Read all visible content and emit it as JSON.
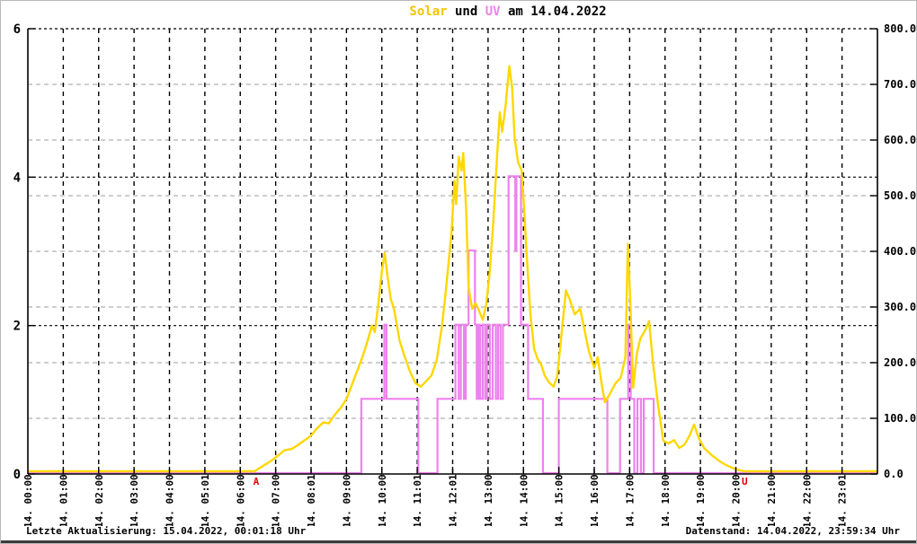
{
  "title": {
    "parts": [
      {
        "text": "Solar",
        "color": "#f5c400"
      },
      {
        "text": " und ",
        "color": "#000000"
      },
      {
        "text": "UV",
        "color": "#ee82ee"
      },
      {
        "text": " am 14.04.2022",
        "color": "#000000"
      }
    ]
  },
  "footer": {
    "left": "Letzte Aktualisierung: 15.04.2022, 00:01:18 Uhr",
    "right": "Datenstand: 14.04.2022, 23:59:34 Uhr"
  },
  "chart_data": {
    "type": "line",
    "title": "Solar und UV am 14.04.2022",
    "grid": {
      "hour_line_color": "#000000",
      "left_line_color": "#000000",
      "right_line_color": "#bdbdbd"
    },
    "x_axis": {
      "hours": [
        0,
        1,
        2,
        3,
        4,
        5,
        6,
        7,
        8,
        9,
        10,
        11,
        12,
        13,
        14,
        15,
        16,
        17,
        18,
        19,
        20,
        21,
        22,
        23
      ],
      "labels": [
        "14. 00:00",
        "14. 01:00",
        "14. 02:00",
        "14. 03:00",
        "14. 04:00",
        "14. 05:01",
        "14. 06:00",
        "14. 07:00",
        "14. 08:01",
        "14. 09:00",
        "14. 10:00",
        "14. 11:01",
        "14. 12:01",
        "14. 13:00",
        "14. 14:00",
        "14. 15:00",
        "14. 16:00",
        "14. 17:00",
        "14. 18:00",
        "14. 19:00",
        "14. 20:00",
        "14. 21:00",
        "14. 22:00",
        "14. 23:01"
      ],
      "range": [
        0,
        24
      ]
    },
    "left_axis": {
      "range": [
        0,
        6
      ],
      "ticks": [
        0,
        2,
        4,
        6
      ],
      "tick_labels": [
        "0",
        "2",
        "4",
        "6"
      ]
    },
    "right_axis": {
      "range": [
        0,
        800
      ],
      "ticks": [
        0,
        100,
        200,
        300,
        400,
        500,
        600,
        700,
        800
      ],
      "tick_labels": [
        "0.0",
        "100.0",
        "200.0",
        "300.0",
        "400.0",
        "500.0",
        "600.0",
        "700.0",
        "800.0"
      ]
    },
    "sun_markers": {
      "color": "#e00000",
      "items": [
        {
          "label": "A",
          "hour": 6.45
        },
        {
          "label": "U",
          "hour": 20.25
        }
      ]
    },
    "series": [
      {
        "name": "UV",
        "axis": "left",
        "color": "#ee82ee",
        "style": "step",
        "points": [
          [
            0,
            0
          ],
          [
            9.42,
            1
          ],
          [
            10.07,
            2
          ],
          [
            10.13,
            1
          ],
          [
            11.03,
            0
          ],
          [
            11.57,
            1
          ],
          [
            12.08,
            2
          ],
          [
            12.17,
            1
          ],
          [
            12.23,
            2
          ],
          [
            12.32,
            1
          ],
          [
            12.37,
            2
          ],
          [
            12.45,
            3
          ],
          [
            12.63,
            2
          ],
          [
            12.68,
            1
          ],
          [
            12.73,
            2
          ],
          [
            12.78,
            1
          ],
          [
            12.85,
            2
          ],
          [
            12.92,
            1
          ],
          [
            12.97,
            2
          ],
          [
            13.05,
            1
          ],
          [
            13.13,
            2
          ],
          [
            13.22,
            1
          ],
          [
            13.28,
            2
          ],
          [
            13.35,
            1
          ],
          [
            13.42,
            2
          ],
          [
            13.58,
            4
          ],
          [
            13.77,
            3
          ],
          [
            13.8,
            4
          ],
          [
            13.93,
            2
          ],
          [
            14.13,
            1
          ],
          [
            14.55,
            0
          ],
          [
            15.0,
            1
          ],
          [
            16.37,
            0
          ],
          [
            16.73,
            1
          ],
          [
            16.96,
            2
          ],
          [
            17.03,
            1
          ],
          [
            17.13,
            0
          ],
          [
            17.22,
            1
          ],
          [
            17.32,
            0
          ],
          [
            17.4,
            1
          ],
          [
            17.68,
            0
          ],
          [
            24,
            0
          ]
        ]
      },
      {
        "name": "Solar",
        "axis": "right",
        "color": "#ffd700",
        "style": "line",
        "points": [
          [
            0,
            0
          ],
          [
            6.4,
            0
          ],
          [
            6.55,
            6
          ],
          [
            6.7,
            12
          ],
          [
            6.9,
            20
          ],
          [
            7.1,
            30
          ],
          [
            7.25,
            38
          ],
          [
            7.45,
            40
          ],
          [
            7.6,
            46
          ],
          [
            7.8,
            55
          ],
          [
            8.0,
            64
          ],
          [
            8.15,
            76
          ],
          [
            8.35,
            88
          ],
          [
            8.5,
            86
          ],
          [
            8.65,
            100
          ],
          [
            8.85,
            115
          ],
          [
            9.0,
            130
          ],
          [
            9.15,
            155
          ],
          [
            9.3,
            180
          ],
          [
            9.45,
            205
          ],
          [
            9.6,
            235
          ],
          [
            9.72,
            262
          ],
          [
            9.8,
            250
          ],
          [
            9.9,
            300
          ],
          [
            10.0,
            360
          ],
          [
            10.08,
            392
          ],
          [
            10.15,
            355
          ],
          [
            10.25,
            310
          ],
          [
            10.35,
            290
          ],
          [
            10.5,
            235
          ],
          [
            10.65,
            205
          ],
          [
            10.8,
            178
          ],
          [
            10.95,
            158
          ],
          [
            11.1,
            152
          ],
          [
            11.25,
            162
          ],
          [
            11.4,
            172
          ],
          [
            11.55,
            200
          ],
          [
            11.7,
            262
          ],
          [
            11.8,
            320
          ],
          [
            11.9,
            385
          ],
          [
            11.97,
            430
          ],
          [
            12.05,
            522
          ],
          [
            12.1,
            480
          ],
          [
            12.17,
            565
          ],
          [
            12.25,
            540
          ],
          [
            12.3,
            572
          ],
          [
            12.38,
            470
          ],
          [
            12.45,
            330
          ],
          [
            12.55,
            292
          ],
          [
            12.65,
            302
          ],
          [
            12.75,
            288
          ],
          [
            12.85,
            272
          ],
          [
            12.95,
            300
          ],
          [
            13.05,
            360
          ],
          [
            13.15,
            450
          ],
          [
            13.25,
            560
          ],
          [
            13.33,
            645
          ],
          [
            13.4,
            610
          ],
          [
            13.5,
            660
          ],
          [
            13.6,
            728
          ],
          [
            13.68,
            690
          ],
          [
            13.75,
            600
          ],
          [
            13.85,
            555
          ],
          [
            13.95,
            540
          ],
          [
            14.02,
            470
          ],
          [
            14.1,
            380
          ],
          [
            14.2,
            280
          ],
          [
            14.3,
            220
          ],
          [
            14.4,
            202
          ],
          [
            14.5,
            192
          ],
          [
            14.6,
            172
          ],
          [
            14.72,
            160
          ],
          [
            14.85,
            152
          ],
          [
            14.95,
            170
          ],
          [
            15.05,
            230
          ],
          [
            15.2,
            325
          ],
          [
            15.3,
            310
          ],
          [
            15.45,
            282
          ],
          [
            15.6,
            292
          ],
          [
            15.72,
            255
          ],
          [
            15.85,
            215
          ],
          [
            16.0,
            186
          ],
          [
            16.1,
            205
          ],
          [
            16.2,
            160
          ],
          [
            16.3,
            124
          ],
          [
            16.45,
            140
          ],
          [
            16.6,
            158
          ],
          [
            16.75,
            168
          ],
          [
            16.88,
            205
          ],
          [
            16.95,
            408
          ],
          [
            17.02,
            300
          ],
          [
            17.1,
            150
          ],
          [
            17.2,
            210
          ],
          [
            17.3,
            238
          ],
          [
            17.45,
            255
          ],
          [
            17.55,
            270
          ],
          [
            17.65,
            200
          ],
          [
            17.8,
            120
          ],
          [
            17.95,
            55
          ],
          [
            18.1,
            50
          ],
          [
            18.25,
            56
          ],
          [
            18.4,
            42
          ],
          [
            18.55,
            48
          ],
          [
            18.7,
            65
          ],
          [
            18.82,
            84
          ],
          [
            18.95,
            60
          ],
          [
            19.1,
            42
          ],
          [
            19.3,
            30
          ],
          [
            19.5,
            20
          ],
          [
            19.7,
            12
          ],
          [
            19.9,
            6
          ],
          [
            20.1,
            2
          ],
          [
            20.25,
            0
          ],
          [
            24,
            0
          ]
        ]
      }
    ]
  }
}
